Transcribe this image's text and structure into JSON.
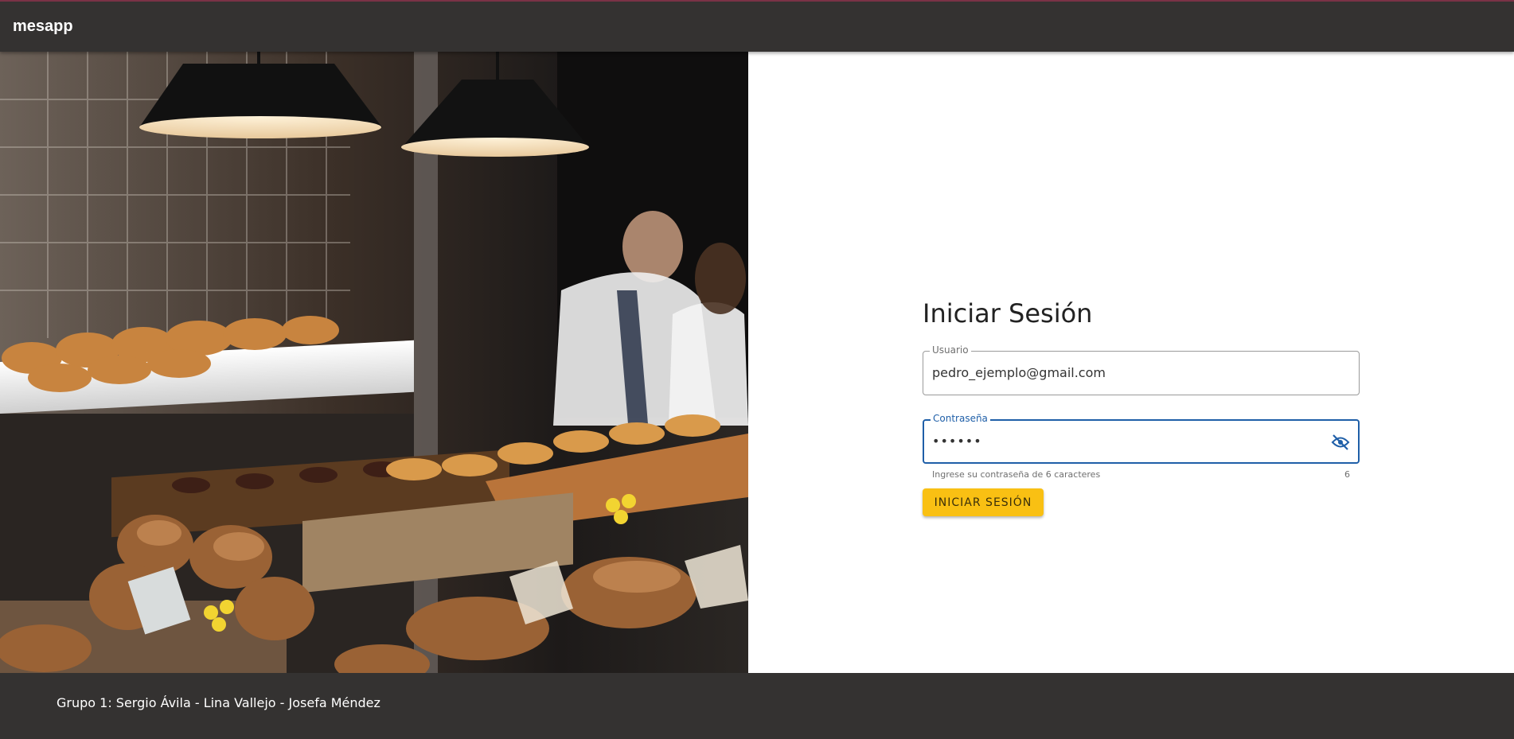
{
  "header": {
    "brand": "mesapp"
  },
  "hero": {
    "image": "bakery-counter-photo"
  },
  "login": {
    "title": "Iniciar Sesión",
    "username": {
      "label": "Usuario",
      "value": "pedro_ejemplo@gmail.com"
    },
    "password": {
      "label": "Contraseña",
      "value": "••••••",
      "helper": "Ingrese su contraseña de 6 caracteres",
      "counter": "6",
      "toggle_icon": "eye-off-icon"
    },
    "submit_label": "INICIAR SESIÓN"
  },
  "footer": {
    "credits": "Grupo 1: Sergio Ávila - Lina Vallejo - Josefa Méndez"
  },
  "colors": {
    "header_bg": "#343231",
    "accent_button": "#f9c013",
    "focus_blue": "#1f5fa8"
  }
}
